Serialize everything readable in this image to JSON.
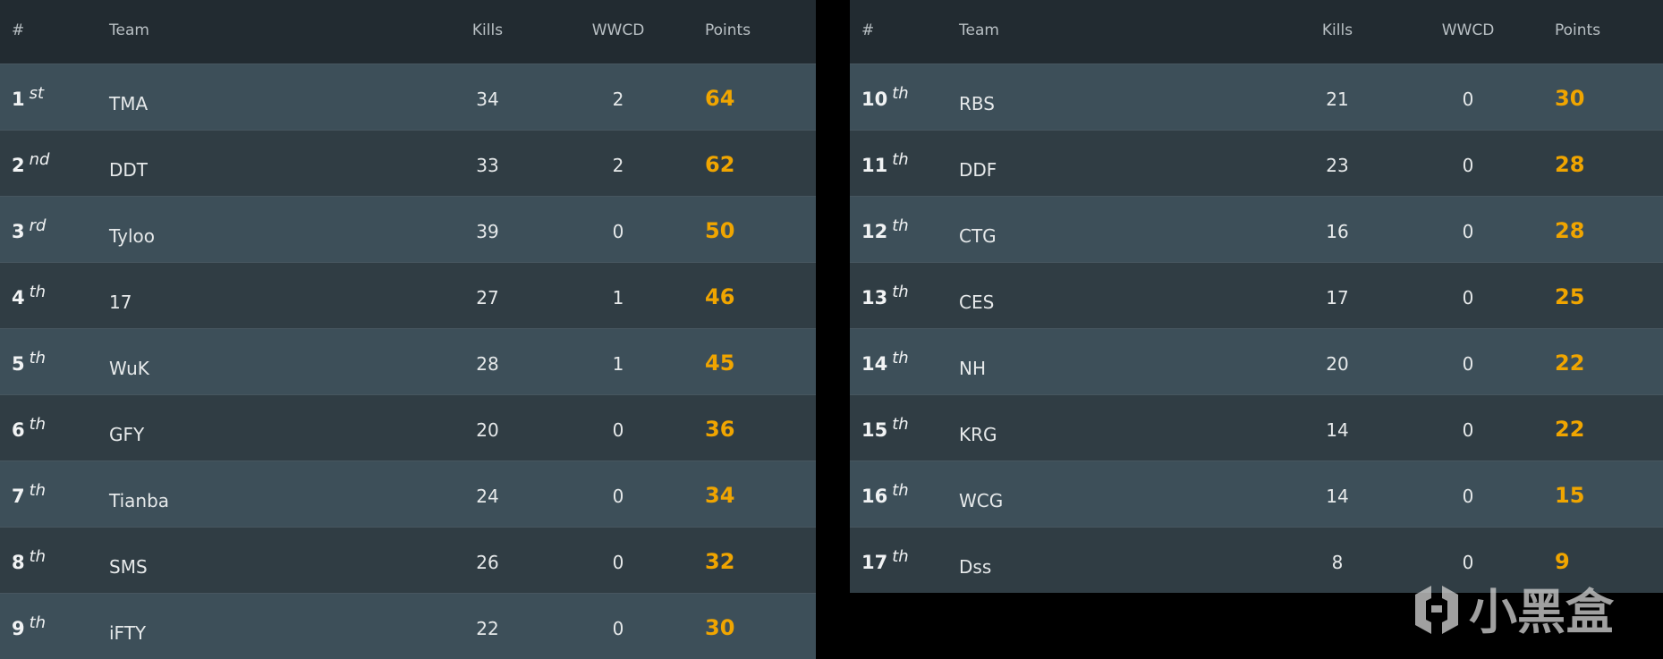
{
  "header": {
    "rank": "#",
    "team": "Team",
    "kills": "Kills",
    "wwcd": "WWCD",
    "points": "Points"
  },
  "colors": {
    "points": "#f0a500",
    "header_bg": "#222b31",
    "row_light": "#3d4f59",
    "row_dark": "#303d44"
  },
  "left_rows": [
    {
      "rank": "1",
      "suffix": "st",
      "team": "TMA",
      "kills": "34",
      "wwcd": "2",
      "points": "64"
    },
    {
      "rank": "2",
      "suffix": "nd",
      "team": "DDT",
      "kills": "33",
      "wwcd": "2",
      "points": "62"
    },
    {
      "rank": "3",
      "suffix": "rd",
      "team": "Tyloo",
      "kills": "39",
      "wwcd": "0",
      "points": "50"
    },
    {
      "rank": "4",
      "suffix": "th",
      "team": "17",
      "kills": "27",
      "wwcd": "1",
      "points": "46"
    },
    {
      "rank": "5",
      "suffix": "th",
      "team": "WuK",
      "kills": "28",
      "wwcd": "1",
      "points": "45"
    },
    {
      "rank": "6",
      "suffix": "th",
      "team": "GFY",
      "kills": "20",
      "wwcd": "0",
      "points": "36"
    },
    {
      "rank": "7",
      "suffix": "th",
      "team": "Tianba",
      "kills": "24",
      "wwcd": "0",
      "points": "34"
    },
    {
      "rank": "8",
      "suffix": "th",
      "team": "SMS",
      "kills": "26",
      "wwcd": "0",
      "points": "32"
    },
    {
      "rank": "9",
      "suffix": "th",
      "team": "iFTY",
      "kills": "22",
      "wwcd": "0",
      "points": "30"
    }
  ],
  "right_rows": [
    {
      "rank": "10",
      "suffix": "th",
      "team": "RBS",
      "kills": "21",
      "wwcd": "0",
      "points": "30"
    },
    {
      "rank": "11",
      "suffix": "th",
      "team": "DDF",
      "kills": "23",
      "wwcd": "0",
      "points": "28"
    },
    {
      "rank": "12",
      "suffix": "th",
      "team": "CTG",
      "kills": "16",
      "wwcd": "0",
      "points": "28"
    },
    {
      "rank": "13",
      "suffix": "th",
      "team": "CES",
      "kills": "17",
      "wwcd": "0",
      "points": "25"
    },
    {
      "rank": "14",
      "suffix": "th",
      "team": "NH",
      "kills": "20",
      "wwcd": "0",
      "points": "22"
    },
    {
      "rank": "15",
      "suffix": "th",
      "team": "KRG",
      "kills": "14",
      "wwcd": "0",
      "points": "22"
    },
    {
      "rank": "16",
      "suffix": "th",
      "team": "WCG",
      "kills": "14",
      "wwcd": "0",
      "points": "15"
    },
    {
      "rank": "17",
      "suffix": "th",
      "team": "Dss",
      "kills": "8",
      "wwcd": "0",
      "points": "9"
    }
  ],
  "watermark": {
    "text": "小黑盒",
    "icon": "heybox-logo-icon"
  }
}
